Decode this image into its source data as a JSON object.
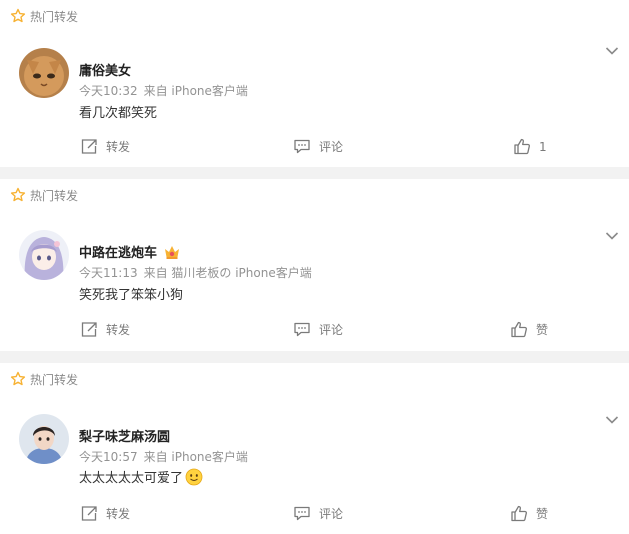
{
  "colors": {
    "accent_star": "#f7b233",
    "separator": "#f2f2f2",
    "meta": "#939393"
  },
  "comments": [
    {
      "hot_label": "热门转发",
      "author": "庸俗美女",
      "time": "今天10:32",
      "source": "来自 iPhone客户端",
      "text": "看几次都笑死",
      "repost_label": "转发",
      "comment_label": "评论",
      "like_label": "1",
      "avatar": "orange-cat"
    },
    {
      "hot_label": "热门转发",
      "author": "中路在逃炮车",
      "time": "今天11:13",
      "source": "来自 猫川老板の iPhone客户端",
      "text": "笑死我了笨笨小狗",
      "repost_label": "转发",
      "comment_label": "评论",
      "like_label": "赞",
      "avatar": "anime-girl",
      "badge": "crown-badge-icon"
    },
    {
      "hot_label": "热门转发",
      "author": "梨子味芝麻汤圆",
      "time": "今天10:57",
      "source": "来自 iPhone客户端",
      "text": "太太太太太可爱了",
      "repost_label": "转发",
      "comment_label": "评论",
      "like_label": "赞",
      "avatar": "boy-photo",
      "emoji": "smile-emoji-icon"
    }
  ]
}
